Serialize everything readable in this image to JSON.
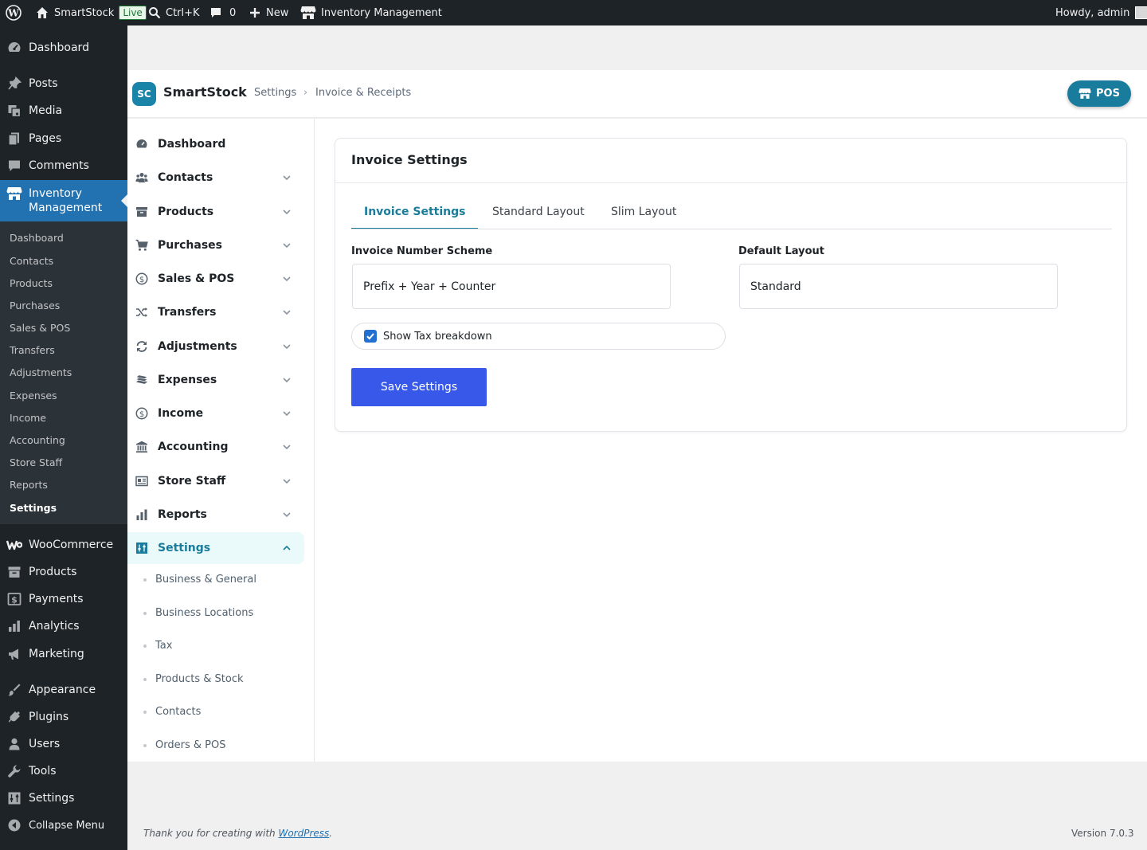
{
  "admin_bar": {
    "site_name": "SmartStock",
    "live_badge": "Live",
    "search_shortcut": "Ctrl+K",
    "comments_count": "0",
    "new_label": "New",
    "plugin_link": "Inventory Management",
    "greeting": "Howdy, admin"
  },
  "wp_menu": {
    "items": [
      {
        "label": "Dashboard",
        "icon": "dashboard-icon"
      },
      {
        "label": "Posts",
        "icon": "pin-icon"
      },
      {
        "label": "Media",
        "icon": "media-icon"
      },
      {
        "label": "Pages",
        "icon": "pages-icon"
      },
      {
        "label": "Comments",
        "icon": "comment-icon"
      },
      {
        "label": "Inventory Management",
        "icon": "store-icon"
      },
      {
        "label": "WooCommerce",
        "icon": "woo-icon"
      },
      {
        "label": "Products",
        "icon": "archive-icon"
      },
      {
        "label": "Payments",
        "icon": "payment-icon"
      },
      {
        "label": "Analytics",
        "icon": "bar-chart-icon"
      },
      {
        "label": "Marketing",
        "icon": "megaphone-icon"
      },
      {
        "label": "Appearance",
        "icon": "brush-icon"
      },
      {
        "label": "Plugins",
        "icon": "plug-icon"
      },
      {
        "label": "Users",
        "icon": "user-icon"
      },
      {
        "label": "Tools",
        "icon": "wrench-icon"
      },
      {
        "label": "Settings",
        "icon": "settings-sliders-icon"
      },
      {
        "label": "Collapse Menu",
        "icon": "collapse-icon"
      }
    ],
    "submenu": [
      "Dashboard",
      "Contacts",
      "Products",
      "Purchases",
      "Sales & POS",
      "Transfers",
      "Adjustments",
      "Expenses",
      "Income",
      "Accounting",
      "Store Staff",
      "Reports",
      "Settings"
    ]
  },
  "header": {
    "logo_initials": "SC",
    "brand": "SmartStock",
    "breadcrumb": [
      "Settings",
      "Invoice & Receipts"
    ],
    "breadcrumb_separator": "›",
    "pos_button": "POS"
  },
  "plugin_sidebar": {
    "items": [
      {
        "label": "Dashboard",
        "icon": "gauge-icon"
      },
      {
        "label": "Contacts",
        "icon": "users-icon"
      },
      {
        "label": "Products",
        "icon": "box-icon"
      },
      {
        "label": "Purchases",
        "icon": "cart-icon"
      },
      {
        "label": "Sales & POS",
        "icon": "dollar-circle-icon"
      },
      {
        "label": "Transfers",
        "icon": "shuffle-icon"
      },
      {
        "label": "Adjustments",
        "icon": "sync-icon"
      },
      {
        "label": "Expenses",
        "icon": "money-stack-icon"
      },
      {
        "label": "Income",
        "icon": "dollar-circle-icon"
      },
      {
        "label": "Accounting",
        "icon": "bank-icon"
      },
      {
        "label": "Store Staff",
        "icon": "id-card-icon"
      },
      {
        "label": "Reports",
        "icon": "bar-chart-icon"
      },
      {
        "label": "Settings",
        "icon": "settings-sliders-icon"
      }
    ],
    "settings_subitems": [
      "Business & General",
      "Business Locations",
      "Tax",
      "Products & Stock",
      "Contacts",
      "Orders & POS"
    ]
  },
  "card": {
    "title": "Invoice Settings",
    "tabs": [
      "Invoice Settings",
      "Standard Layout",
      "Slim Layout"
    ],
    "active_tab": "Invoice Settings",
    "invoice_number_scheme": {
      "label": "Invoice Number Scheme",
      "value": "Prefix + Year + Counter"
    },
    "default_layout": {
      "label": "Default Layout",
      "value": "Standard"
    },
    "show_tax_breakdown": {
      "label": "Show Tax breakdown",
      "checked": true
    },
    "save_button": "Save Settings"
  },
  "footer": {
    "thanks_prefix": "Thank you for creating with ",
    "thanks_link": "WordPress",
    "thanks_suffix": ".",
    "version": "Version 7.0.3"
  },
  "colors": {
    "admin_bar_bg": "#1d2327",
    "current_menu": "#2271b1",
    "brand_teal": "#1a7c9c",
    "save_button": "#3858e9",
    "checkbox": "#2271d1"
  }
}
